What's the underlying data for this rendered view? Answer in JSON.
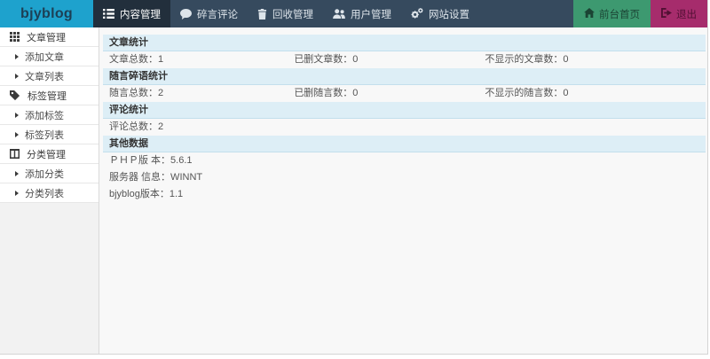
{
  "brand": {
    "logo": "bjyblog"
  },
  "navbar": {
    "items": [
      {
        "label": "内容管理",
        "icon": "list-icon",
        "active": true
      },
      {
        "label": "碎言评论",
        "icon": "comment-icon",
        "active": false
      },
      {
        "label": "回收管理",
        "icon": "trash-icon",
        "active": false
      },
      {
        "label": "用户管理",
        "icon": "users-icon",
        "active": false
      },
      {
        "label": "网站设置",
        "icon": "gears-icon",
        "active": false
      }
    ],
    "actions": [
      {
        "label": "前台首页",
        "icon": "home-icon"
      },
      {
        "label": "退出",
        "icon": "sign-out-icon"
      }
    ]
  },
  "sidebar": {
    "items": [
      {
        "label": "文章管理",
        "type": "header",
        "icon": "th-grid-icon"
      },
      {
        "label": "添加文章",
        "type": "link"
      },
      {
        "label": "文章列表",
        "type": "link"
      },
      {
        "label": "标签管理",
        "type": "header",
        "icon": "tags-icon"
      },
      {
        "label": "添加标签",
        "type": "link"
      },
      {
        "label": "标签列表",
        "type": "link"
      },
      {
        "label": "分类管理",
        "type": "header",
        "icon": "columns-icon"
      },
      {
        "label": "添加分类",
        "type": "link"
      },
      {
        "label": "分类列表",
        "type": "link"
      }
    ]
  },
  "main": {
    "sections": [
      {
        "title": "文章统计",
        "rows": [
          {
            "cells": [
              "文章总数：1",
              "已删文章数：0",
              "不显示的文章数：0"
            ]
          }
        ]
      },
      {
        "title": "随言碎语统计",
        "rows": [
          {
            "cells": [
              "随言总数：2",
              "已删随言数：0",
              "不显示的随言数：0"
            ]
          }
        ]
      },
      {
        "title": "评论统计",
        "rows": [
          {
            "cells": [
              "评论总数：2"
            ]
          }
        ]
      },
      {
        "title": "其他数据",
        "rows": [
          {
            "cells": [
              "ＰＨＰ版 本：5.6.1"
            ]
          },
          {
            "cells": [
              "服务器 信息：WINNT"
            ]
          },
          {
            "cells": [
              "bjyblog版本：1.1"
            ]
          }
        ]
      }
    ]
  },
  "colors": {
    "logo_bg": "#1ea2cd",
    "navbar_bg": "#364a5e",
    "navbar_active_bg": "#222f3c",
    "front_button_bg": "#3d9970",
    "logout_button_bg": "#a62c6c",
    "section_header_bg": "#ddeef6",
    "main_bg": "#f8f8f8"
  }
}
